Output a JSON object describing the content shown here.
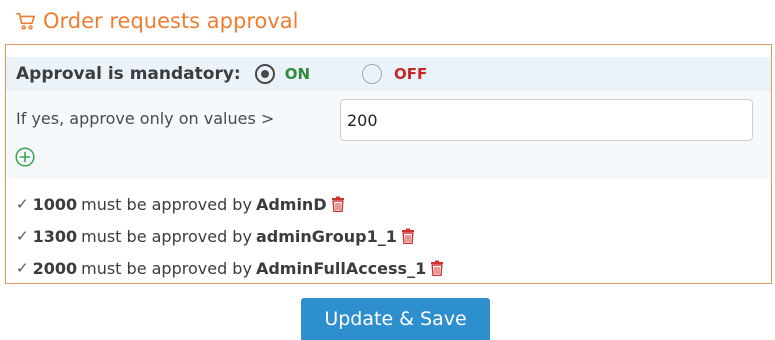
{
  "header": {
    "title": "Order requests approval",
    "icon": "cart-icon",
    "color": "#ef7d31"
  },
  "mandatory": {
    "label": "Approval is mandatory:",
    "on_label": "ON",
    "off_label": "OFF",
    "selected": "ON"
  },
  "threshold": {
    "prompt": "If yes, approve only on values >",
    "value": "200",
    "add_icon": "plus-circle-icon"
  },
  "rules": [
    {
      "amount": "1000",
      "text": "must be approved by",
      "approver": "AdminD"
    },
    {
      "amount": "1300",
      "text": "must be approved by",
      "approver": "adminGroup1_1"
    },
    {
      "amount": "2000",
      "text": "must be approved by",
      "approver": "AdminFullAccess_1"
    }
  ],
  "actions": {
    "save_label": "Update & Save"
  },
  "colors": {
    "accent": "#ef7d31",
    "on": "#2e8b3a",
    "off": "#c62828",
    "delete": "#d32f2f",
    "button": "#2e8fcf"
  }
}
